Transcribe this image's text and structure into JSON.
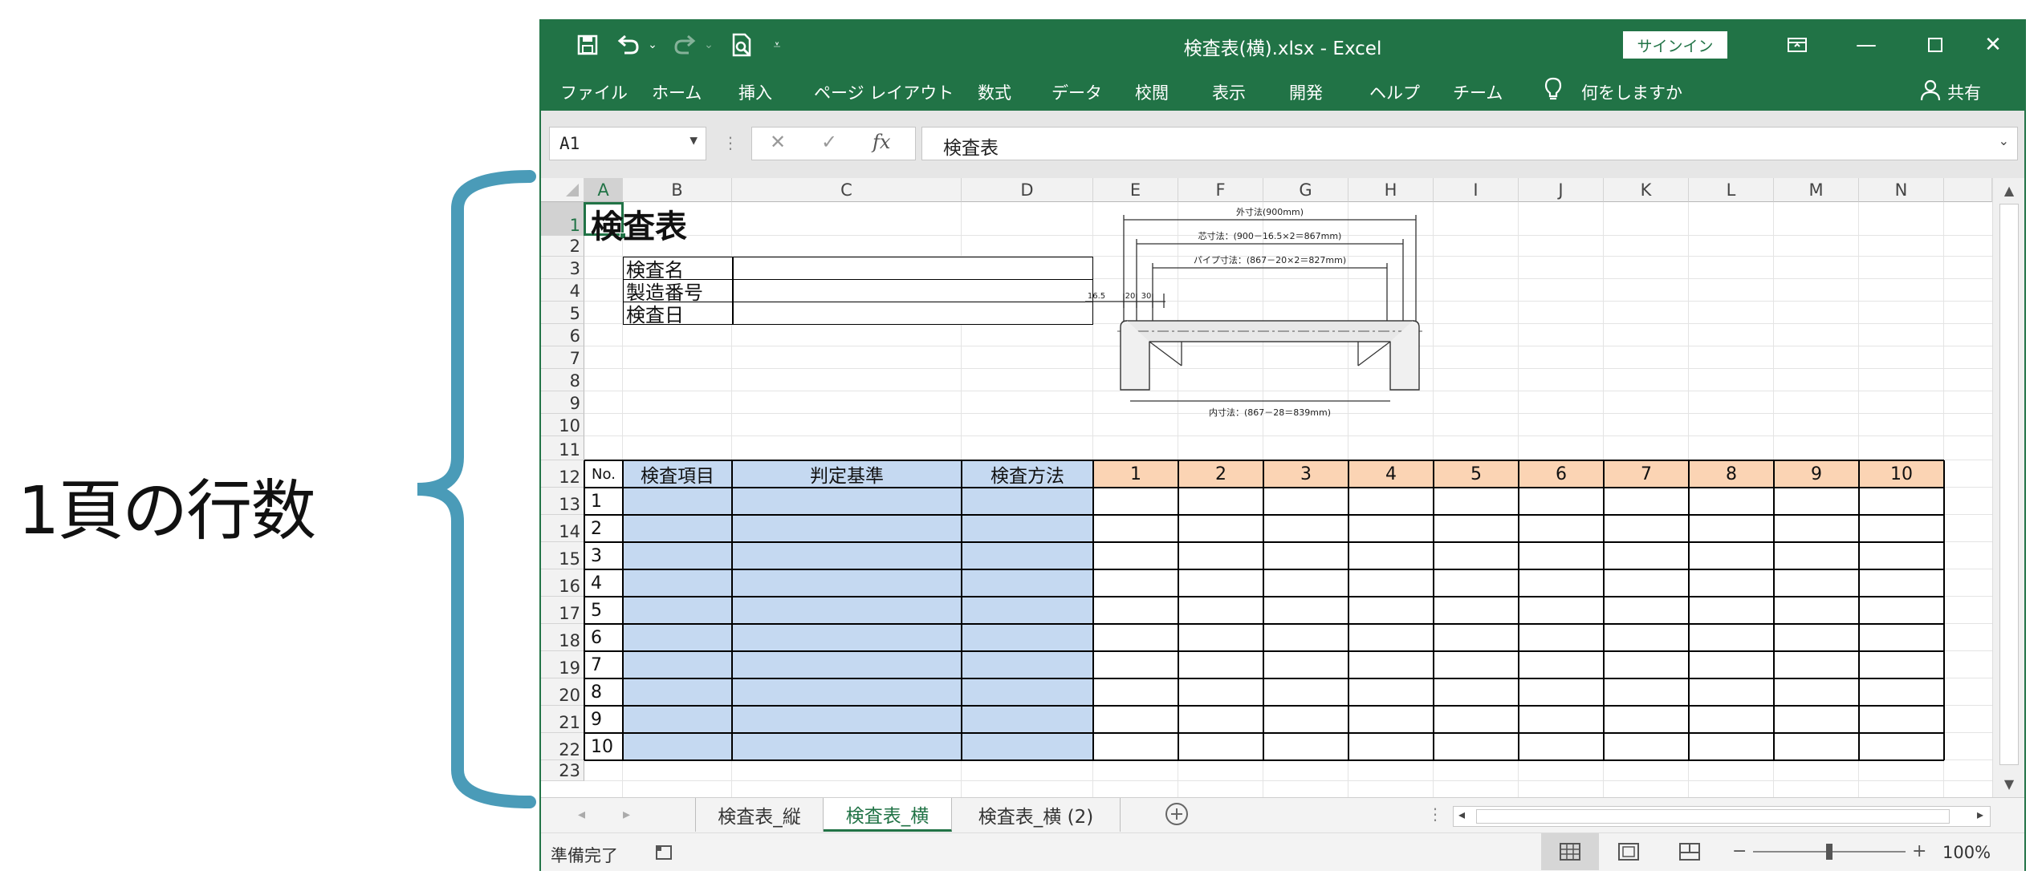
{
  "annotation": {
    "label": "1頁の行数"
  },
  "titlebar": {
    "title": "検査表(横).xlsx  -  Excel",
    "signin": "サインイン",
    "save_icon": "save-icon",
    "undo_icon": "undo-icon",
    "redo_icon": "redo-icon",
    "preview_icon": "print-preview-icon"
  },
  "ribbon": {
    "tabs": [
      "ファイル",
      "ホーム",
      "挿入",
      "ページ レイアウト",
      "数式",
      "データ",
      "校閲",
      "表示",
      "開発",
      "ヘルプ",
      "チーム"
    ],
    "tell_me": "何をしますか",
    "share": "共有"
  },
  "formula_bar": {
    "name_box": "A1",
    "content": "検査表"
  },
  "columns": [
    "A",
    "B",
    "C",
    "D",
    "E",
    "F",
    "G",
    "H",
    "I",
    "J",
    "K",
    "L",
    "M",
    "N"
  ],
  "rows": [
    "1",
    "2",
    "3",
    "4",
    "5",
    "6",
    "7",
    "8",
    "9",
    "10",
    "11",
    "12",
    "13",
    "14",
    "15",
    "16",
    "17",
    "18",
    "19",
    "20",
    "21",
    "22",
    "23"
  ],
  "sheet": {
    "title": "検査表",
    "info_labels": [
      "検査名",
      "製造番号",
      "検査日"
    ],
    "table_headers": {
      "no": "No.",
      "item": "検査項目",
      "criteria": "判定基準",
      "method": "検査方法"
    },
    "sample_numbers": [
      "1",
      "2",
      "3",
      "4",
      "5",
      "6",
      "7",
      "8",
      "9",
      "10"
    ],
    "row_numbers": [
      "1",
      "2",
      "3",
      "4",
      "5",
      "6",
      "7",
      "8",
      "9",
      "10"
    ],
    "drawing": {
      "outer": "外寸法(900mm)",
      "core": "芯寸法：(900－16.5×2＝867mm)",
      "pipe": "パイプ寸法：(867－20×2＝827mm)",
      "inner": "内寸法：(867－28＝839mm)",
      "d1": "16.5",
      "d2": "20",
      "d3": "30"
    }
  },
  "sheet_tabs": [
    "検査表_縦",
    "検査表_横",
    "検査表_横 (2)"
  ],
  "active_sheet": "検査表_横",
  "status": {
    "ready": "準備完了",
    "zoom": "100%"
  },
  "colors": {
    "excel_green": "#217346",
    "blue_fill": "#c5d9f1",
    "orange_fill": "#fbd4b4",
    "brace": "#4a9bb8"
  }
}
